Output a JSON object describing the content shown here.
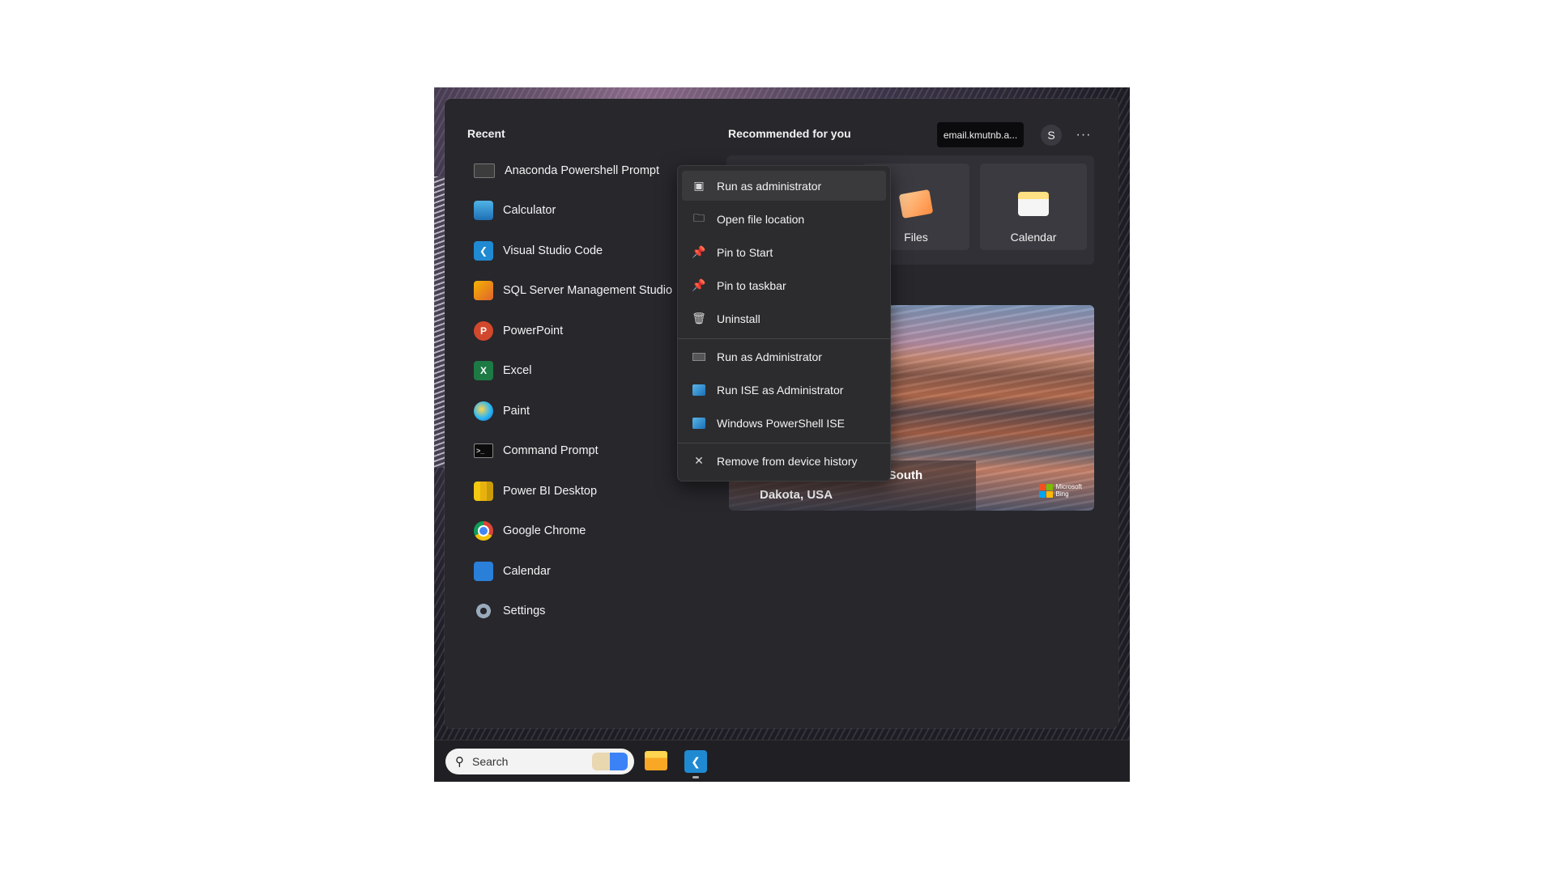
{
  "start_menu": {
    "recent_title": "Recent",
    "recommended_title": "Recommended for you",
    "account_label": "email.kmutnb.a...",
    "avatar_letter": "S",
    "more_glyph": "···",
    "recent_items": [
      {
        "label": "Anaconda Powershell Prompt",
        "icon": "terminal-icon"
      },
      {
        "label": "Calculator",
        "icon": "calculator-icon"
      },
      {
        "label": "Visual Studio Code",
        "icon": "vscode-icon"
      },
      {
        "label": "SQL Server Management Studio",
        "icon": "sql-server-icon"
      },
      {
        "label": "PowerPoint",
        "icon": "powerpoint-icon"
      },
      {
        "label": "Excel",
        "icon": "excel-icon"
      },
      {
        "label": "Paint",
        "icon": "paint-icon"
      },
      {
        "label": "Command Prompt",
        "icon": "command-prompt-icon"
      },
      {
        "label": "Power BI Desktop",
        "icon": "power-bi-icon"
      },
      {
        "label": "Google Chrome",
        "icon": "chrome-icon"
      },
      {
        "label": "Calendar",
        "icon": "calendar-icon"
      },
      {
        "label": "Settings",
        "icon": "settings-icon"
      }
    ],
    "tiles": [
      {
        "label": "Files",
        "icon": "files-icon"
      },
      {
        "label": "Calendar",
        "icon": "calendar-icon"
      }
    ],
    "bing": {
      "caption_line1": "k, South",
      "caption_line2": "Dakota, USA",
      "logo_line1": "Microsoft",
      "logo_line2": "Bing"
    }
  },
  "context_menu": {
    "items": [
      {
        "label": "Run as administrator",
        "icon": "shield-app-icon"
      },
      {
        "label": "Open file location",
        "icon": "folder-icon"
      },
      {
        "label": "Pin to Start",
        "icon": "pin-icon"
      },
      {
        "label": "Pin to taskbar",
        "icon": "pin-icon"
      },
      {
        "label": "Uninstall",
        "icon": "trash-icon"
      },
      {
        "label": "Run as Administrator",
        "icon": "console-icon"
      },
      {
        "label": "Run ISE as Administrator",
        "icon": "powershell-ise-icon"
      },
      {
        "label": "Windows PowerShell ISE",
        "icon": "powershell-ise-icon"
      },
      {
        "label": "Remove from device history",
        "icon": "close-icon"
      }
    ]
  },
  "taskbar": {
    "search_placeholder": "Search"
  },
  "colors": {
    "menu_background": "#28272c",
    "context_menu_background": "#2c2c2e",
    "taskbar_background": "#202024"
  }
}
